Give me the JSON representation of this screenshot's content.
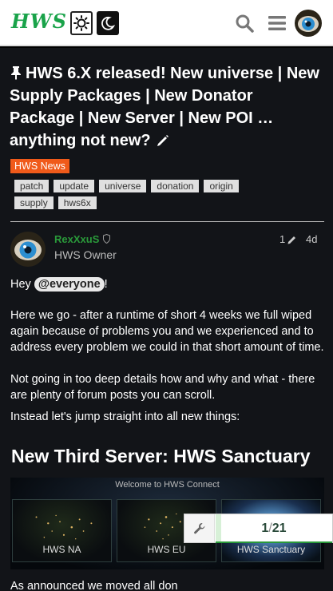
{
  "header": {
    "logo_text": "HWS",
    "icons": [
      "light-theme-icon",
      "dark-theme-icon",
      "search-icon",
      "hamburger-menu-icon",
      "avatar"
    ]
  },
  "topic": {
    "title": "HWS 6.X released! New universe | New Supply Packages | New Donator Package | New Server | New POI … anything not new?",
    "category": "HWS News",
    "category_color": "#f05a1a",
    "tags": [
      "patch",
      "update",
      "universe",
      "donation",
      "origin",
      "supply",
      "hws6x"
    ]
  },
  "post": {
    "username": "RexXxuS",
    "user_title": "HWS Owner",
    "edit_count": "1",
    "age": "4d",
    "greeting": "Hey",
    "mention": "@everyone",
    "greeting_end": "!",
    "paragraph1": "Here we go - after a runtime of short 4 weeks we full wiped again because of problems you and we experienced and to address every problem we could in that short amount of time.",
    "paragraph2": "Not going in too deep details how and why and what - there are plenty of forum posts you can scroll.",
    "paragraph3": "Instead let's jump straight into all new things:",
    "heading": "New Third Server: HWS Sanctuary",
    "banner": {
      "title": "Welcome to HWS Connect",
      "servers": [
        "HWS NA",
        "HWS EU",
        "HWS Sanctuary"
      ]
    },
    "cutoff_text": "As announced we moved all don"
  },
  "progress": {
    "current": "1",
    "separator": "/",
    "total": "21",
    "fraction": 0.05
  }
}
